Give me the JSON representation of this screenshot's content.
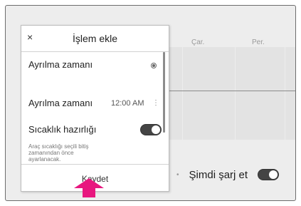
{
  "calendar": {
    "day_headers": [
      "Çar.",
      "Per."
    ]
  },
  "now_charge": {
    "separator": "•",
    "label": "Şimdi şarj et",
    "toggle_on": true
  },
  "dialog": {
    "close_glyph": "×",
    "title": "İşlem ekle",
    "departure_row_1": {
      "label": "Ayrılma zamanı",
      "selected": true
    },
    "departure_row_2": {
      "label": "Ayrılma zamanı",
      "time": "12:00 AM",
      "more_glyph": "⋮"
    },
    "climate": {
      "label": "Sıcaklık hazırlığı",
      "description": "Araç sıcaklığı seçili bitiş zamanından önce ayarlanacak.",
      "toggle_on": true
    },
    "save_label": "Kaydet"
  },
  "colors": {
    "annotation_arrow": "#e8177f",
    "toggle_on": "#444444"
  },
  "icons": {
    "close": "close-icon",
    "more": "more-vertical-icon",
    "arrow": "up-arrow-annotation"
  }
}
